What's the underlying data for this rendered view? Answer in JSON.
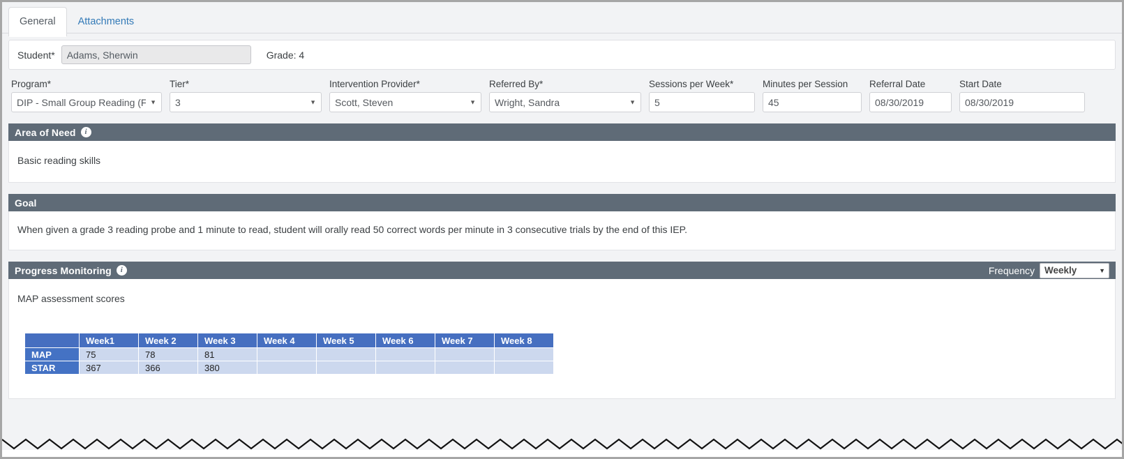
{
  "tabs": [
    {
      "label": "General",
      "active": true
    },
    {
      "label": "Attachments",
      "active": false
    }
  ],
  "student_bar": {
    "student_label": "Student*",
    "student_value": "Adams, Sherwin",
    "grade_text": "Grade: 4"
  },
  "fields": {
    "program": {
      "label": "Program*",
      "value": "DIP - Small Group Reading (F"
    },
    "tier": {
      "label": "Tier*",
      "value": "3"
    },
    "intervention_provider": {
      "label": "Intervention Provider*",
      "value": "Scott, Steven"
    },
    "referred_by": {
      "label": "Referred By*",
      "value": "Wright, Sandra"
    },
    "sessions_per_week": {
      "label": "Sessions per Week*",
      "value": "5"
    },
    "minutes_per_session": {
      "label": "Minutes per Session",
      "value": "45"
    },
    "referral_date": {
      "label": "Referral Date",
      "value": "08/30/2019"
    },
    "start_date": {
      "label": "Start Date",
      "value": "08/30/2019"
    }
  },
  "area_of_need": {
    "title": "Area of Need",
    "info_icon": "info-icon",
    "text": "Basic reading skills"
  },
  "goal": {
    "title": "Goal",
    "text": "When given a grade 3 reading probe and 1 minute to read, student will orally read 50 correct words per minute in 3 consecutive trials by the end of this IEP."
  },
  "progress_monitoring": {
    "title": "Progress Monitoring",
    "info_icon": "info-icon",
    "frequency_label": "Frequency",
    "frequency_value": "Weekly",
    "note": "MAP assessment scores"
  },
  "chart_data": {
    "type": "table",
    "title": "MAP assessment scores",
    "corner_header": "",
    "categories": [
      "Week1",
      "Week 2",
      "Week 3",
      "Week 4",
      "Week 5",
      "Week 6",
      "Week 7",
      "Week 8"
    ],
    "series": [
      {
        "name": "MAP",
        "values": [
          "75",
          "78",
          "81",
          "",
          "",
          "",
          "",
          ""
        ]
      },
      {
        "name": "STAR",
        "values": [
          "367",
          "366",
          "380",
          "",
          "",
          "",
          "",
          ""
        ]
      }
    ]
  },
  "icons": {
    "caret_down": "▼"
  },
  "colors": {
    "section_header": "#5f6b77",
    "table_header": "#466fc0",
    "table_rowhead": "#4472c4",
    "table_cell": "#ccd8ee",
    "link": "#337ab7"
  }
}
